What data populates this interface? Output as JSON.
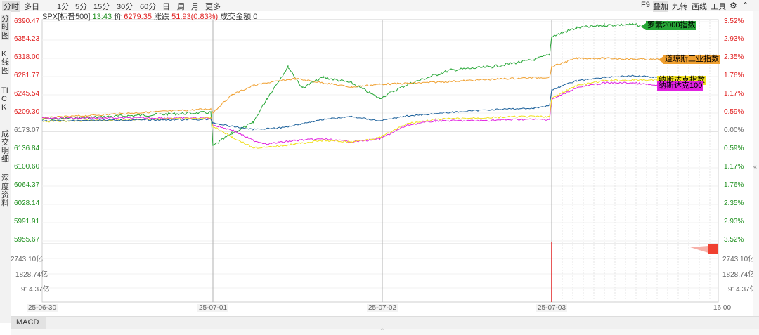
{
  "toolbar": {
    "left": [
      {
        "label": "分时",
        "active": true
      },
      {
        "label": "多日"
      },
      {
        "label": "1分"
      },
      {
        "label": "5分"
      },
      {
        "label": "15分"
      },
      {
        "label": "30分"
      },
      {
        "label": "60分"
      },
      {
        "label": "日"
      },
      {
        "label": "周"
      },
      {
        "label": "月"
      },
      {
        "label": "更多"
      }
    ],
    "right": [
      {
        "label": "F9"
      },
      {
        "label": "叠加",
        "active": true
      },
      {
        "label": "九转"
      },
      {
        "label": "画线"
      },
      {
        "label": "工具"
      }
    ]
  },
  "side_tabs": [
    "分时图",
    "K线图",
    "TICK",
    "成交明细",
    "深度资料"
  ],
  "info": {
    "symbol": "SPX[标普500]",
    "time": "13:43",
    "price_label": "价",
    "price": "6279.35",
    "change_label": "涨跌",
    "change": "51.93(0.83%)",
    "amount_label": "成交金额",
    "amount": "0"
  },
  "y_axis": {
    "prices": [
      "6390.47",
      "6354.23",
      "6318.00",
      "6281.77",
      "6245.54",
      "6209.30",
      "6173.07",
      "6136.84",
      "6100.60",
      "6064.37",
      "6028.14",
      "5991.91",
      "5955.67"
    ],
    "percents": [
      "3.52%",
      "2.93%",
      "2.35%",
      "1.76%",
      "1.17%",
      "0.59%",
      "0.00%",
      "0.59%",
      "1.17%",
      "1.76%",
      "2.35%",
      "2.93%",
      "3.52%"
    ],
    "volumes": [
      "2743.10亿",
      "1828.74亿",
      "914.37亿"
    ]
  },
  "x_axis": [
    "25-06-30",
    "25-07-01",
    "25-07-02",
    "25-07-03",
    "16:00"
  ],
  "overlays": [
    {
      "name": "罗素2000指数",
      "color": "#27a737"
    },
    {
      "name": "道琼斯工业指数",
      "color": "#f0a030"
    },
    {
      "name": "纳斯达克指数",
      "color": "#f0e020"
    },
    {
      "name": "纳斯达克100",
      "color": "#e020e0"
    }
  ],
  "colors": {
    "up": "#e02020",
    "down": "#209020",
    "main": "#1a5f9a"
  },
  "bottom": {
    "indicator": "MACD"
  }
}
